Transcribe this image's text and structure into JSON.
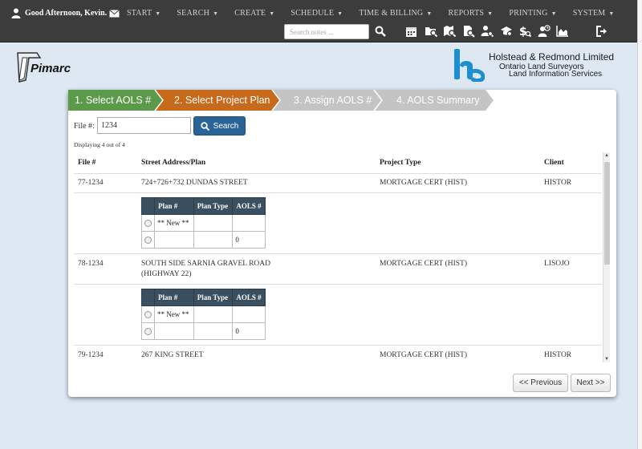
{
  "header": {
    "greeting": "Good Afternoon, Kevin.",
    "menu": [
      "START",
      "SEARCH",
      "CREATE",
      "SCHEDULE",
      "TIME & BILLING",
      "REPORTS",
      "PRINTING",
      "SYSTEM"
    ],
    "search_placeholder": "Search notes ...",
    "tool_icons": [
      "calendar-icon",
      "folder-search-icon",
      "map-search-icon",
      "document-search-icon",
      "user-search-icon",
      "group-search-icon",
      "billing-search-icon",
      "user-clock-icon",
      "chart-icon"
    ]
  },
  "brand": {
    "app_logo": "Pimarc",
    "company": "Holstead & Redmond Limited",
    "sub1": "Ontario Land Surveyors",
    "sub2": "Land Information Services"
  },
  "steps": [
    {
      "label": "1. Select AOLS #",
      "state": "done",
      "color": "#5a9a4a"
    },
    {
      "label": "2. Select Project Plan",
      "state": "active",
      "color": "#c76a1c"
    },
    {
      "label": "3. Assign AOLS #",
      "state": "pending",
      "color": "#c4c4c4"
    },
    {
      "label": "4. AOLS Summary",
      "state": "pending",
      "color": "#c4c4c4"
    }
  ],
  "search": {
    "file_label": "File #:",
    "file_value": "1234",
    "button_label": "Search"
  },
  "result_count": "Displaying 4 out of 4",
  "table": {
    "columns": [
      "File #",
      "Street Address/Plan",
      "Project Type",
      "Client"
    ],
    "rows": [
      {
        "file": "77-1234",
        "address": "724+726+732 DUNDAS STREET",
        "address2": "",
        "type": "MORTGAGE CERT (HIST)",
        "client": "HISTOR"
      },
      {
        "file": "78-1234",
        "address": "SOUTH SIDE SARNIA GRAVEL ROAD",
        "address2": "(HIGHWAY 22)",
        "type": "MORTGAGE CERT (HIST)",
        "client": "LISOJO"
      },
      {
        "file": "79-1234",
        "address": "267 KING STREET",
        "address2": "",
        "type": "MORTGAGE CERT (HIST)",
        "client": "HISTOR"
      }
    ],
    "sub_columns": [
      "Plan #",
      "Plan Type",
      "AOLS #"
    ],
    "sub_rows": [
      {
        "plan": "** New **",
        "plan_type": "",
        "aols": ""
      },
      {
        "plan": "",
        "plan_type": "",
        "aols": "0"
      }
    ]
  },
  "pager": {
    "prev": "<< Previous",
    "next": "Next >>"
  },
  "colors": {
    "nav_bg": "#3c3c3c",
    "accent": "#2a6496",
    "sub_header": "#3a4f5f"
  }
}
